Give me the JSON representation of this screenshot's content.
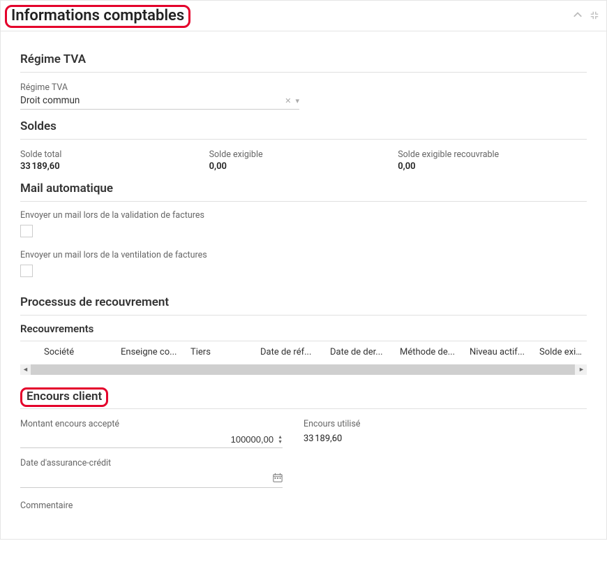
{
  "panel": {
    "title": "Informations comptables"
  },
  "regime_tva": {
    "heading": "Régime TVA",
    "field_label": "Régime TVA",
    "value": "Droit commun"
  },
  "soldes": {
    "heading": "Soldes",
    "total_label": "Solde total",
    "total_value": "33 189,60",
    "exigible_label": "Solde exigible",
    "exigible_value": "0,00",
    "recouvrable_label": "Solde exigible recouvrable",
    "recouvrable_value": "0,00"
  },
  "mail": {
    "heading": "Mail automatique",
    "validation_label": "Envoyer un mail lors de la validation de factures",
    "ventilation_label": "Envoyer un mail lors de la ventilation de factures"
  },
  "recouvrement": {
    "heading": "Processus de recouvrement",
    "table_heading": "Recouvrements",
    "columns": {
      "societe": "Société",
      "enseigne": "Enseigne co...",
      "tiers": "Tiers",
      "date_ref": "Date de réf...",
      "date_der": "Date de der...",
      "methode": "Méthode de...",
      "niveau": "Niveau actif...",
      "solde": "Solde exigib."
    }
  },
  "encours": {
    "heading": "Encours client",
    "accepte_label": "Montant encours accepté",
    "accepte_value": "100000,00",
    "utilise_label": "Encours utilisé",
    "utilise_value": "33 189,60",
    "date_label": "Date d'assurance-crédit",
    "date_value": "",
    "comment_label": "Commentaire"
  }
}
